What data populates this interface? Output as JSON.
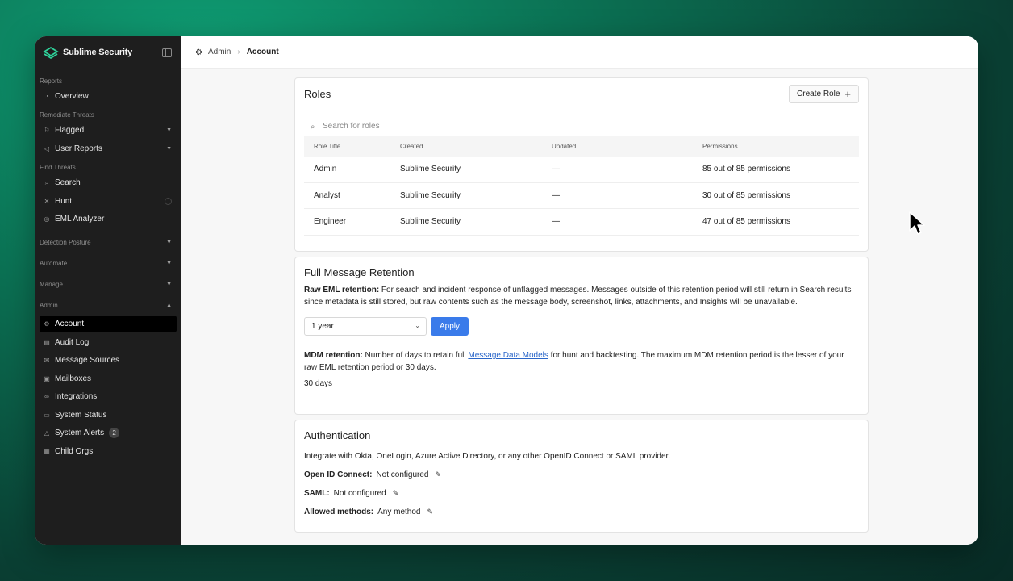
{
  "brand": {
    "name": "Sublime Security"
  },
  "sidebar": {
    "sections": {
      "reports": "Reports",
      "remediate": "Remediate Threats",
      "find": "Find Threats",
      "posture": "Detection Posture",
      "automate": "Automate",
      "manage": "Manage",
      "admin": "Admin"
    },
    "items": {
      "overview": "Overview",
      "flagged": "Flagged",
      "user_reports": "User Reports",
      "search": "Search",
      "hunt": "Hunt",
      "eml_analyzer": "EML Analyzer",
      "account": "Account",
      "audit_log": "Audit Log",
      "message_sources": "Message Sources",
      "mailboxes": "Mailboxes",
      "integrations": "Integrations",
      "system_status": "System Status",
      "system_alerts": "System Alerts",
      "system_alerts_count": "2",
      "child_orgs": "Child Orgs"
    },
    "active_item": "account"
  },
  "breadcrumb": {
    "root": "Admin",
    "current": "Account"
  },
  "roles": {
    "title": "Roles",
    "create_label": "Create Role",
    "search_placeholder": "Search for roles",
    "columns": [
      "Role Title",
      "Created",
      "Updated",
      "Permissions"
    ],
    "rows": [
      [
        "Admin",
        "Sublime Security",
        "—",
        "85 out of 85 permissions"
      ],
      [
        "Analyst",
        "Sublime Security",
        "—",
        "30 out of 85 permissions"
      ],
      [
        "Engineer",
        "Sublime Security",
        "—",
        "47 out of 85 permissions"
      ]
    ]
  },
  "retention": {
    "title": "Full Message Retention",
    "raw_label": "Raw EML retention:",
    "raw_text": " For search and incident response of unflagged messages. Messages outside of this retention period will still return in Search results since metadata is still stored, but raw contents such as the message body, screenshot, links, attachments, and Insights will be unavailable.",
    "select_value": "1 year",
    "apply_label": "Apply",
    "mdm_label": "MDM retention:",
    "mdm_text_before": " Number of days to retain full ",
    "mdm_link": "Message Data Models",
    "mdm_text_after": " for hunt and backtesting. The maximum MDM retention period is the lesser of your raw EML retention period or 30 days.",
    "mdm_value": "30 days"
  },
  "auth": {
    "title": "Authentication",
    "intro": "Integrate with Okta, OneLogin, Azure Active Directory, or any other OpenID Connect or SAML provider.",
    "oidc_label": "Open ID Connect:",
    "oidc_value": "Not configured",
    "saml_label": "SAML:",
    "saml_value": "Not configured",
    "methods_label": "Allowed methods:",
    "methods_value": "Any method"
  },
  "colors": {
    "accent": "#3a7bea",
    "sidebar_bg": "#1e1e1e",
    "link": "#2a66c9"
  }
}
